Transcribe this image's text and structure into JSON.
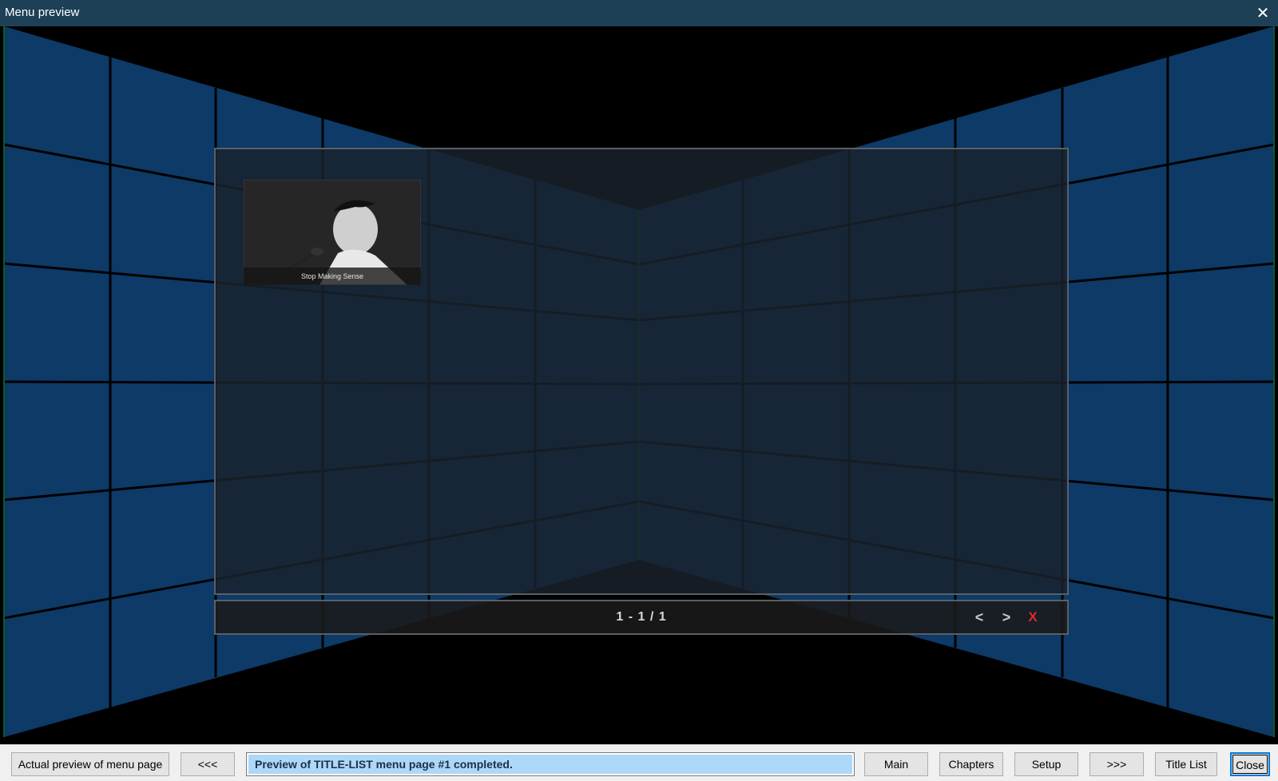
{
  "window": {
    "title": "Menu preview",
    "close_icon": "close-icon"
  },
  "menu": {
    "thumbnail_caption": "Stop Making Sense",
    "page_counter": "1 - 1 / 1",
    "prev_label": "<",
    "next_label": ">",
    "close_label": "X",
    "close_color": "#e0292d",
    "wall_color": "#0d3a66"
  },
  "footer": {
    "actual_preview_label": "Actual preview of menu page",
    "prev_page_label": "<<<",
    "status_text": "Preview of TITLE-LIST menu page #1 completed.",
    "main_label": "Main",
    "chapters_label": "Chapters",
    "setup_label": "Setup",
    "next_page_label": ">>>",
    "title_list_label": "Title List",
    "close_label": "Close"
  }
}
